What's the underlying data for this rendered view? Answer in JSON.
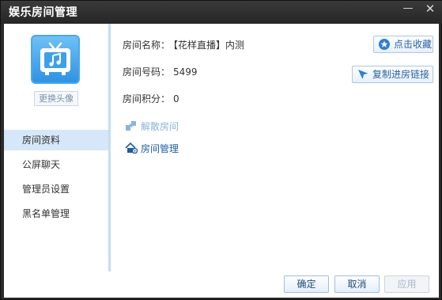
{
  "window": {
    "title": "娱乐房间管理",
    "minimize_glyph": "—",
    "close_glyph": "✕"
  },
  "sidebar": {
    "avatar_icon": "tv-music-icon",
    "change_avatar_label": "更换头像",
    "items": [
      {
        "label": "房间资料",
        "active": true
      },
      {
        "label": "公屏聊天",
        "active": false
      },
      {
        "label": "管理员设置",
        "active": false
      },
      {
        "label": "黑名单管理",
        "active": false
      }
    ]
  },
  "room": {
    "name_label": "房间名称：",
    "name_value": "【花样直播】内测",
    "id_label": "房间号码：",
    "id_value": "5499",
    "points_label": "房间积分：",
    "points_value": "0"
  },
  "actions": {
    "favorite_label": "点击收藏",
    "favorite_icon": "star-icon",
    "copy_link_label": "复制进房链接",
    "copy_link_icon": "airplane-icon",
    "dissolve_label": "解散房间",
    "dissolve_icon": "dissolve-icon",
    "manage_label": "房间管理",
    "manage_icon": "house-gear-icon"
  },
  "footer": {
    "ok_label": "确定",
    "cancel_label": "取消",
    "apply_label": "应用"
  },
  "colors": {
    "accent": "#2f93e3",
    "active_nav": "#d5e7f8",
    "title_bar": "#2a2a2a"
  }
}
